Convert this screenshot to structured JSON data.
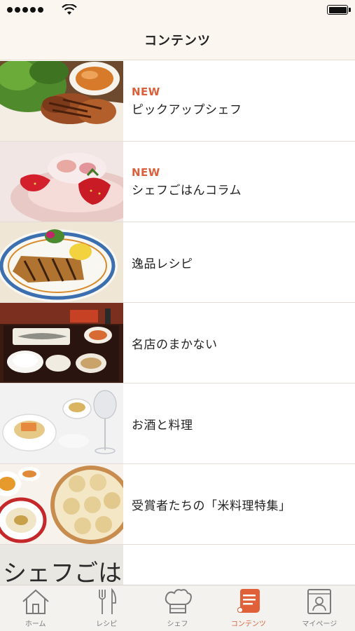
{
  "nav": {
    "title": "コンテンツ"
  },
  "badge_text": "NEW",
  "items": [
    {
      "new": true,
      "label": "ピックアップシェフ",
      "image": "grilled-meat-with-salad"
    },
    {
      "new": true,
      "label": "シェフごはんコラム",
      "image": "strawberry-dessert"
    },
    {
      "new": false,
      "label": "逸品レシピ",
      "image": "grilled-fish-plate"
    },
    {
      "new": false,
      "label": "名店のまかない",
      "image": "japanese-set-meal"
    },
    {
      "new": false,
      "label": "お酒と料理",
      "image": "soup-and-wine"
    },
    {
      "new": false,
      "label": "受賞者たちの「米料理特集」",
      "image": "dim-sum-steamer"
    },
    {
      "new": false,
      "label": "",
      "image_text": "シェフごはん",
      "image": "chef-gohan-logo"
    }
  ],
  "tabs": [
    {
      "label": "ホーム",
      "icon": "home-icon",
      "active": false
    },
    {
      "label": "レシピ",
      "icon": "fork-knife-icon",
      "active": false
    },
    {
      "label": "シェフ",
      "icon": "chef-hat-icon",
      "active": false
    },
    {
      "label": "コンテンツ",
      "icon": "scroll-icon",
      "active": true
    },
    {
      "label": "マイページ",
      "icon": "profile-book-icon",
      "active": false
    }
  ],
  "colors": {
    "accent": "#e0603a",
    "badge": "#d9603a",
    "bar_bg": "#fbf6f0"
  }
}
